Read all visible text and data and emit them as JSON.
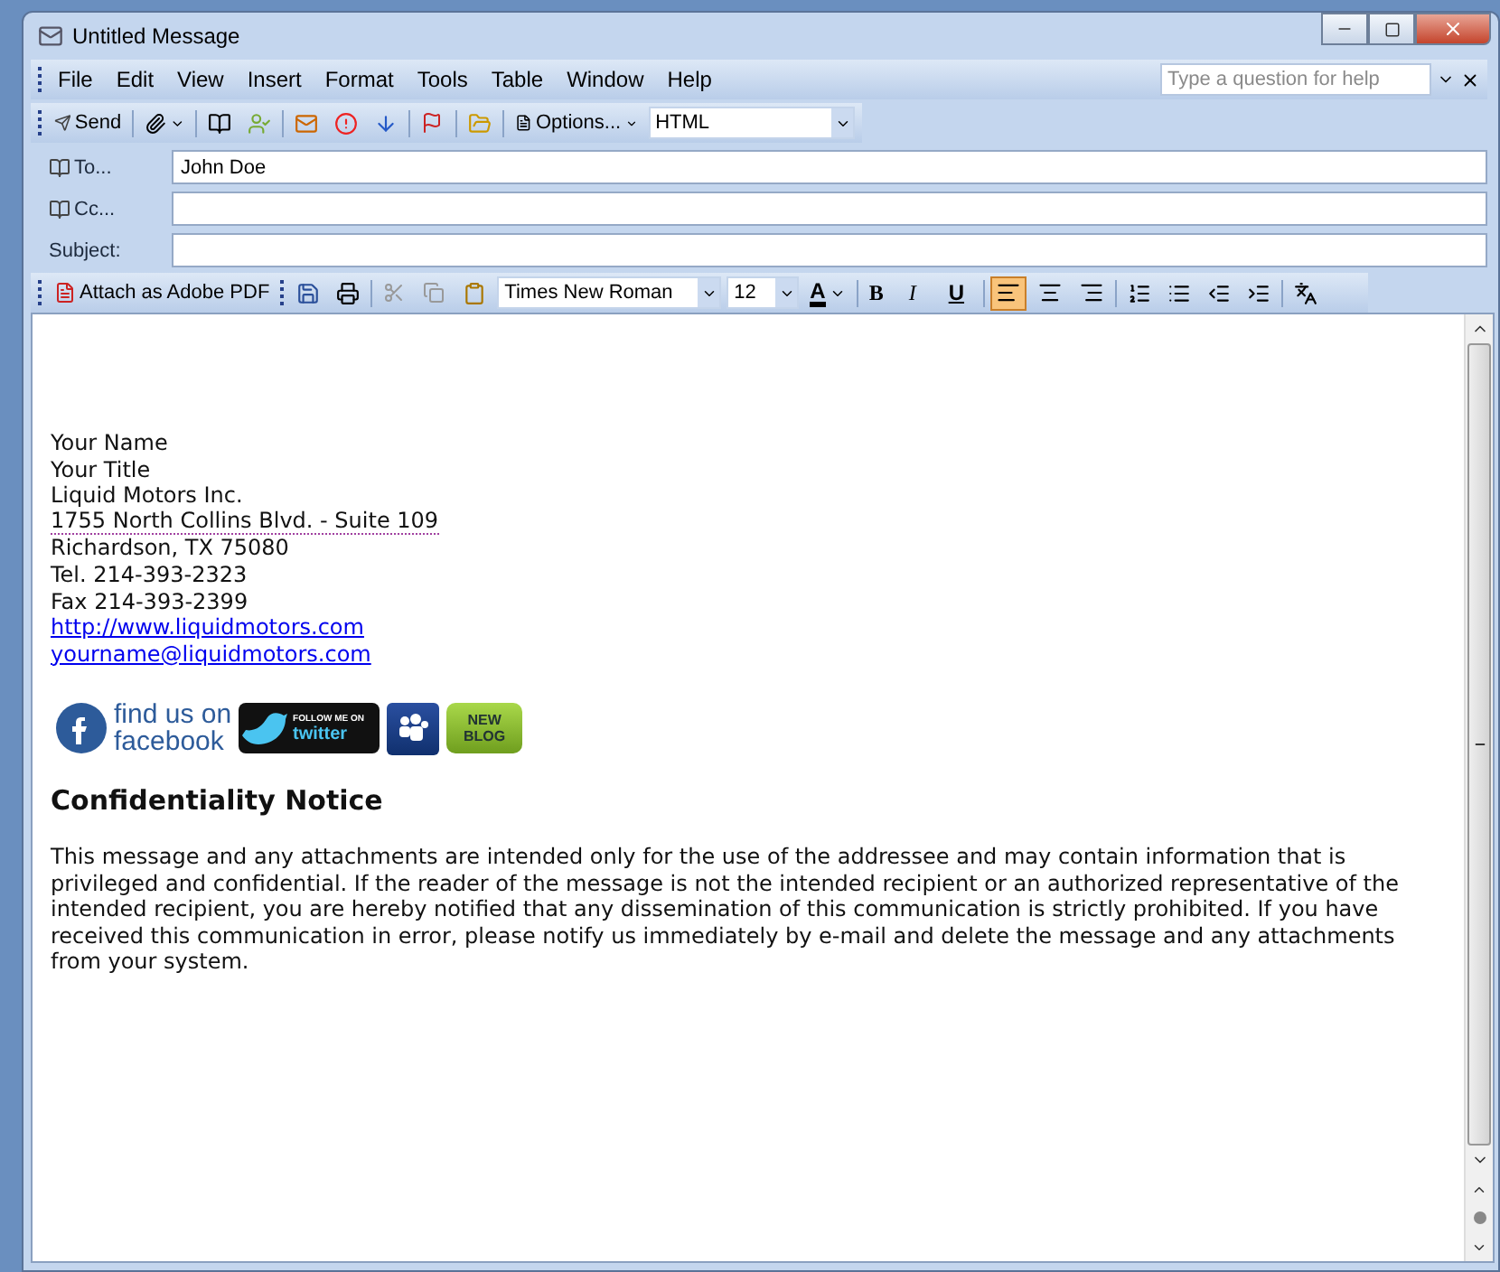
{
  "window": {
    "title": "Untitled Message"
  },
  "menu": [
    "File",
    "Edit",
    "View",
    "Insert",
    "Format",
    "Tools",
    "Table",
    "Window",
    "Help"
  ],
  "help_search": {
    "placeholder": "Type a question for help"
  },
  "toolbar": {
    "send": "Send",
    "options": "Options...",
    "format": "HTML"
  },
  "fields": [
    {
      "label": "To...",
      "book": true,
      "value": "John Doe"
    },
    {
      "label": "Cc...",
      "book": true
    },
    {
      "label": "Subject:",
      "book": false
    }
  ],
  "format_bar": {
    "pdf": "Attach as Adobe PDF",
    "font": "Times New Roman",
    "size": "12",
    "color_letter": "A",
    "bold": "B",
    "italic": "I",
    "underline": "U",
    "align": [
      {
        "kind": "left",
        "selected": true
      },
      {
        "kind": "center",
        "selected": false
      },
      {
        "kind": "right",
        "selected": false
      }
    ]
  },
  "body": {
    "signature": [
      {
        "kind": "line",
        "text": "Your Name"
      },
      {
        "kind": "line",
        "text": "Your Title"
      },
      {
        "kind": "line",
        "text": "Liquid Motors Inc."
      },
      {
        "kind": "tagged",
        "text": "1755 North Collins Blvd. - Suite 109"
      },
      {
        "kind": "line",
        "text": "Richardson, TX 75080"
      },
      {
        "kind": "line",
        "text": "Tel. 214-393-2323"
      },
      {
        "kind": "line",
        "text": "Fax 214-393-2399"
      },
      {
        "kind": "link",
        "text": "http://www.liquidmotors.com"
      },
      {
        "kind": "link",
        "text": "yourname@liquidmotors.com"
      }
    ],
    "badges": [
      {
        "kind": "facebook",
        "lines": [
          "find us on",
          "facebook"
        ]
      },
      {
        "kind": "twitter",
        "lines": [
          "FOLLOW ME ON",
          "twitter"
        ]
      },
      {
        "kind": "myspace"
      },
      {
        "kind": "blog",
        "lines": [
          "NEW",
          "BLOG"
        ]
      }
    ],
    "heading": "Confidentiality Notice",
    "notice": "This message and any attachments are intended only for the use of the addressee and may contain information that is privileged and confidential. If the reader of the message is not the intended recipient or an authorized representative of the intended recipient, you are hereby notified that any dissemination of this communication is strictly prohibited. If you have received this communication in error, please notify us immediately by e-mail and delete the message and any attachments from your system."
  }
}
